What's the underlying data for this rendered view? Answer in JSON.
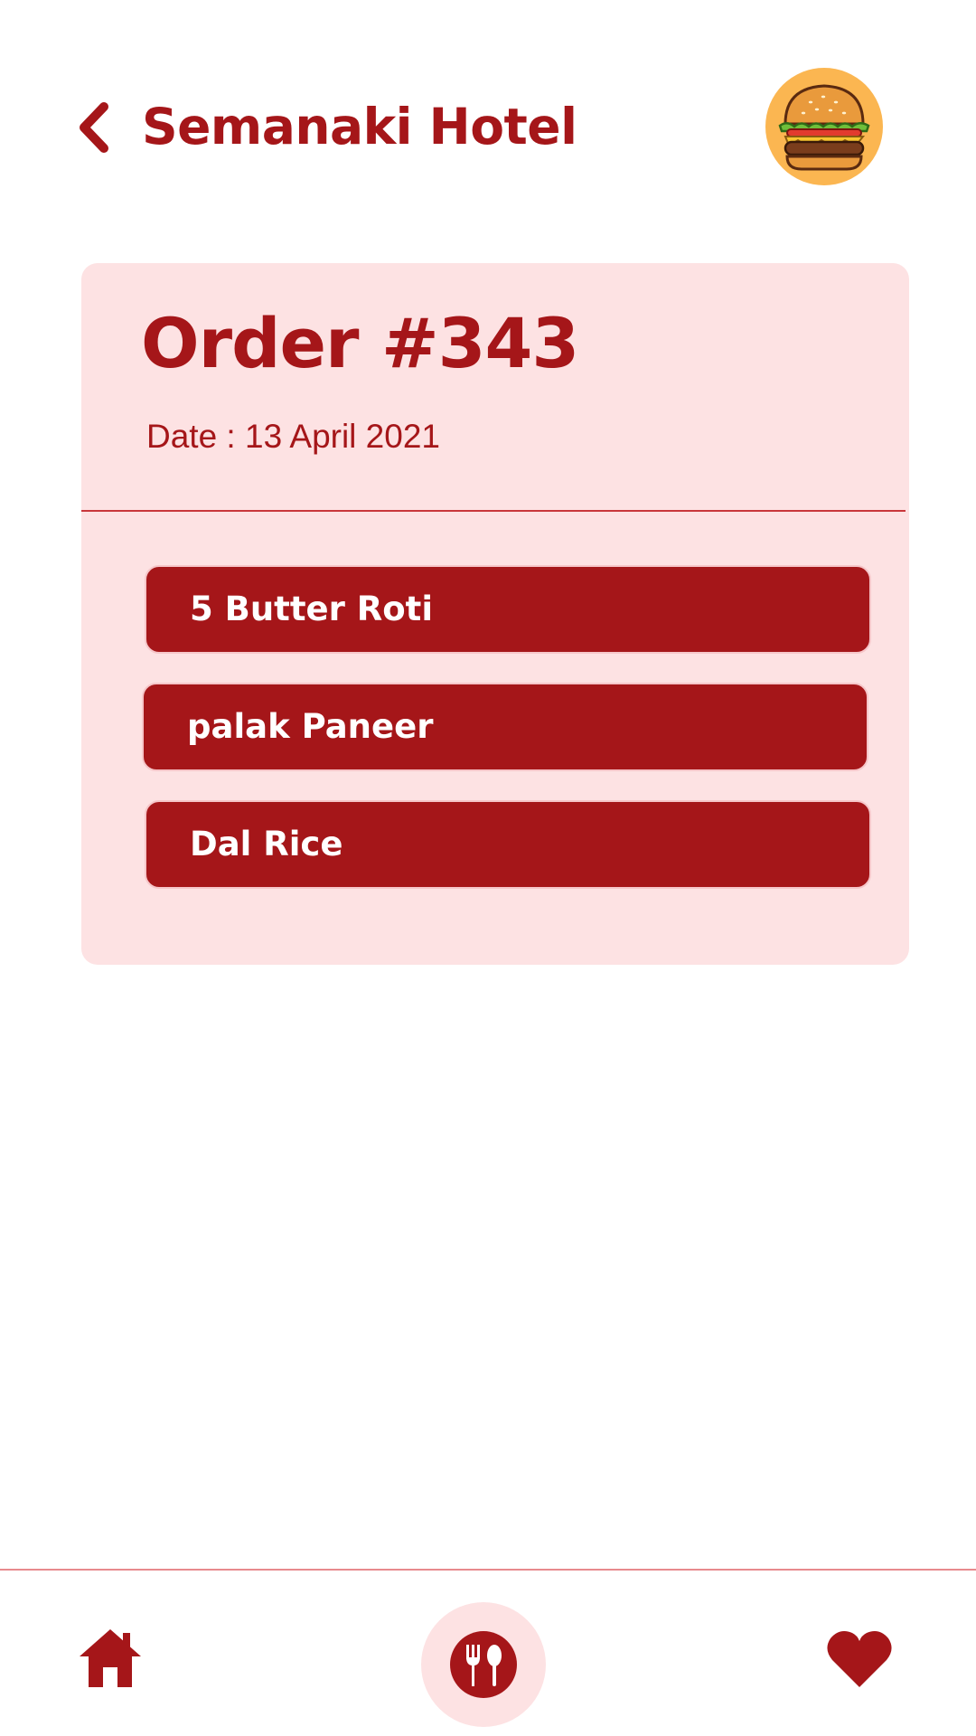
{
  "header": {
    "title": "Semanaki Hotel",
    "back_icon": "chevron-left-icon",
    "avatar_icon": "burger-icon"
  },
  "order": {
    "title": "Order #343",
    "date_label": "Date :  13 April 2021",
    "items": [
      {
        "label": "5 Butter Roti"
      },
      {
        "label": "palak Paneer"
      },
      {
        "label": "Dal Rice"
      }
    ]
  },
  "nav": {
    "items": [
      {
        "icon": "home-icon"
      },
      {
        "icon": "fork-spoon-icon",
        "active": true
      },
      {
        "icon": "heart-icon"
      }
    ]
  },
  "colors": {
    "primary": "#a51619",
    "card_background": "#fde2e3",
    "avatar_background": "#fbb651",
    "background": "#ffffff"
  }
}
